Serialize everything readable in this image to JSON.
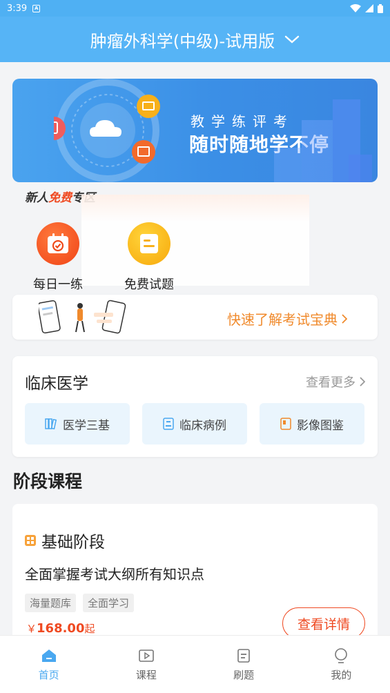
{
  "status_bar": {
    "time": "3:39",
    "notification_icon": "a-box-icon",
    "icons": [
      "wifi-icon",
      "signal-icon",
      "battery-icon"
    ]
  },
  "header": {
    "title": "肿瘤外科学(中级)-试用版",
    "dropdown_icon": "chevron-down-icon"
  },
  "banner": {
    "words": "教学练评考",
    "slogan": "随时随地学不停"
  },
  "newbie": {
    "prefix": "新人",
    "highlight": "免费",
    "suffix": "专区"
  },
  "quick_actions": [
    {
      "label": "每日一练",
      "icon": "calendar-check-icon",
      "color": "#f04a1a"
    },
    {
      "label": "免费试题",
      "icon": "document-icon",
      "color": "#f7b01a"
    }
  ],
  "guide": {
    "link_text": "快速了解考试宝典"
  },
  "clinical": {
    "title": "临床医学",
    "more": "查看更多",
    "items": [
      {
        "label": "医学三基",
        "icon": "books-icon"
      },
      {
        "label": "临床病例",
        "icon": "case-file-icon"
      },
      {
        "label": "影像图鉴",
        "icon": "image-book-icon"
      }
    ]
  },
  "stage": {
    "heading": "阶段课程",
    "course": {
      "title": "基础阶段",
      "description": "全面掌握考试大纲所有知识点",
      "tags": [
        "海量题库",
        "全面学习"
      ],
      "currency": "￥",
      "price": "168.00",
      "price_suffix": "起",
      "button": "查看详情"
    }
  },
  "bottom_nav": [
    {
      "label": "首页",
      "icon": "home-icon",
      "active": true
    },
    {
      "label": "课程",
      "icon": "play-icon",
      "active": false
    },
    {
      "label": "刷题",
      "icon": "list-icon",
      "active": false
    },
    {
      "label": "我的",
      "icon": "user-icon",
      "active": false
    }
  ],
  "colors": {
    "primary": "#56b4f6",
    "accent_orange": "#f08a2c",
    "accent_red": "#ef4a22"
  }
}
